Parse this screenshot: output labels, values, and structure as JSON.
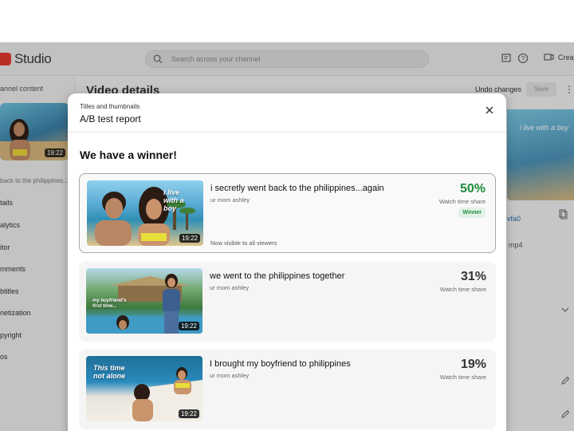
{
  "app": {
    "brand": "Studio",
    "search_placeholder": "Search across your channel",
    "create_label": "Create"
  },
  "sidebar": {
    "heading": "annel content",
    "thumb_duration": "19:22",
    "back_link": "back to the philippines...",
    "items": [
      "tails",
      "alytics",
      "itor",
      "mments",
      "btitles",
      "netization",
      "pyright",
      "os"
    ]
  },
  "page": {
    "title": "Video details",
    "undo_label": "Undo changes",
    "save_label": "Save",
    "right_thumb_caption": "i live with a boy",
    "right_link": "vfa0",
    "right_file": "mp4"
  },
  "dialog": {
    "subtitle": "Titles and thumbnails",
    "title": "A/B test report",
    "headline": "We have a winner!",
    "results": [
      {
        "title": "i secretly went back to the philippines...again",
        "channel": "ur mom ashley",
        "percent": "50%",
        "metric": "Watch time share",
        "badge": "Winner",
        "status": "Now visible to all viewers",
        "duration": "19:22",
        "thumb_caption": "i live with a boy",
        "winner": true
      },
      {
        "title": "we went to the philippines together",
        "channel": "ur mom ashley",
        "percent": "31%",
        "metric": "Watch time share",
        "duration": "19:22",
        "thumb_caption": "my boyfriend's first time...",
        "winner": false
      },
      {
        "title": "I brought my boyfriend to philippines",
        "channel": "ur mom ashley",
        "percent": "19%",
        "metric": "Watch time share",
        "duration": "19:22",
        "thumb_caption": "This time not alone",
        "winner": false
      }
    ]
  },
  "colors": {
    "winner_green": "#1e8e3e",
    "brand_red": "#e23a2f"
  },
  "icons": [
    "search-icon",
    "feedback-icon",
    "help-icon",
    "create-camera-icon",
    "close-icon",
    "kebab-icon",
    "copy-icon",
    "edit-icon",
    "chevron-down-icon"
  ]
}
